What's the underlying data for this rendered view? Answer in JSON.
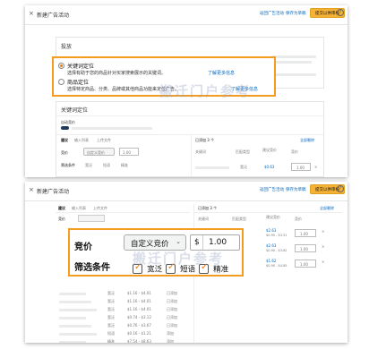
{
  "top": {
    "header": {
      "close": "×",
      "title": "新建广告活动",
      "link1": "返回广告活动",
      "link2": "保存为草稿",
      "submit": "提交以供审核",
      "help": "?"
    },
    "bid_section_title": "投放",
    "keyword_option": {
      "title": "关键词定位",
      "desc_prefix": "选择有助于您的商品针对买家搜索展示的关键词。",
      "more": "了解更多信息"
    },
    "product_option": {
      "title": "商品定位",
      "desc_prefix": "选择特定商品、分类、品牌或其他商品功能来定位广告。",
      "more": "了解更多信息"
    },
    "keyword_targeting_section": "关键词定位",
    "auto_bid_label": "自动竞价",
    "tabs": [
      "建议",
      "输入列表",
      "上传文件"
    ],
    "bid_label": "竞价",
    "bid_select": "自定义竞价",
    "bid_value": "1.00",
    "filter_label": "筛选条件",
    "filter_options": [
      "宽泛",
      "短语",
      "精准"
    ],
    "added_count": "已添加 3 个",
    "remove_all": "全部删除",
    "table_headers": [
      "关键词",
      "匹配类型",
      "建议竞价",
      "竞价"
    ],
    "rows": [
      {
        "match": "宽泛",
        "price": "$0.63",
        "bid": "1.00"
      },
      {
        "match": "短语",
        "price": "$1.71",
        "bid": "1.00"
      }
    ]
  },
  "bottom": {
    "header": {
      "close": "×",
      "title": "新建广告活动",
      "link1": "返回广告活动",
      "link2": "保存为草稿",
      "submit": "提交以供审核",
      "help": "?"
    },
    "tabs": [
      "建议",
      "输入列表",
      "上传文件"
    ],
    "bid_label_small": "竞价",
    "added_count": "已添加 3 个",
    "remove_all": "全部删除",
    "table_headers": [
      "关键词",
      "匹配类型",
      "建议竞价",
      "竞价"
    ],
    "right_rows": [
      {
        "match": "宽泛",
        "price": "$2.63",
        "range": "$0.95 - $3.51",
        "bid": "1.00"
      },
      {
        "match": "短语",
        "price": "$2.63",
        "range": "$0.90 - $3.82",
        "bid": "1.00"
      },
      {
        "match": "精准",
        "price": "$1.62",
        "range": "$0.90 - $4.85",
        "bid": "1.00"
      }
    ],
    "zoom": {
      "bid_label": "竞价",
      "bid_select": "自定义竞价",
      "currency": "$",
      "bid_value": "1.00",
      "filter_label": "筛选条件",
      "filter_options": [
        "宽泛",
        "短语",
        "精准"
      ]
    },
    "left_rows": [
      {
        "match": "宽泛",
        "range": "$1.16 - $4.01",
        "action": "已添加"
      },
      {
        "match": "宽泛",
        "range": "$1.16 - $4.01",
        "action": "已添加"
      },
      {
        "match": "宽泛",
        "range": "$1.16 - $4.01",
        "action": "已添加"
      },
      {
        "match": "宽泛",
        "range": "$0.74 - $3.12",
        "action": "已添加"
      },
      {
        "match": "宽泛",
        "range": "$0.76 - $3.67",
        "action": "已添加"
      },
      {
        "match": "短语",
        "range": "$0.16 - $1.21",
        "action": "添加"
      },
      {
        "match": "精准",
        "range": "$7.54 - $8.63",
        "action": "添加"
      }
    ]
  },
  "watermark": "搬迁门户参考",
  "colors": {
    "accent": "#f39c1f",
    "link": "#0066c0",
    "primary_button": "#f5b235"
  }
}
